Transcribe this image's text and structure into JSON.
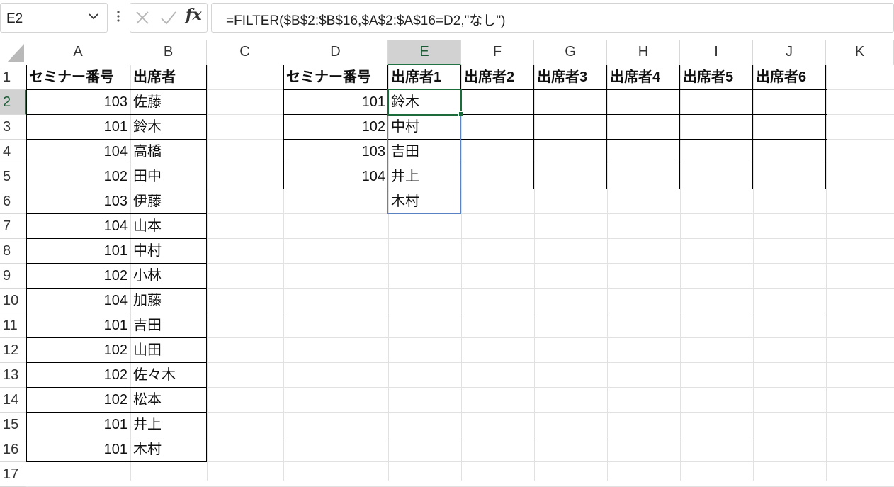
{
  "formula_bar": {
    "name_box": "E2",
    "formula": "=FILTER($B$2:$B$16,$A$2:$A$16=D2,\"なし\")",
    "fx_label": "fx"
  },
  "columns": [
    "A",
    "B",
    "C",
    "D",
    "E",
    "F",
    "G",
    "H",
    "I",
    "J",
    "K"
  ],
  "rows": [
    "1",
    "2",
    "3",
    "4",
    "5",
    "6",
    "7",
    "8",
    "9",
    "10",
    "11",
    "12",
    "13",
    "14",
    "15",
    "16",
    "17"
  ],
  "table_left": {
    "headers": [
      "セミナー番号",
      "出席者"
    ],
    "rows": [
      [
        "103",
        "佐藤"
      ],
      [
        "101",
        "鈴木"
      ],
      [
        "104",
        "高橋"
      ],
      [
        "102",
        "田中"
      ],
      [
        "103",
        "伊藤"
      ],
      [
        "104",
        "山本"
      ],
      [
        "101",
        "中村"
      ],
      [
        "102",
        "小林"
      ],
      [
        "104",
        "加藤"
      ],
      [
        "101",
        "吉田"
      ],
      [
        "102",
        "山田"
      ],
      [
        "102",
        "佐々木"
      ],
      [
        "102",
        "松本"
      ],
      [
        "101",
        "井上"
      ],
      [
        "101",
        "木村"
      ]
    ]
  },
  "table_right": {
    "headers": [
      "セミナー番号",
      "出席者1",
      "出席者2",
      "出席者3",
      "出席者4",
      "出席者5",
      "出席者6"
    ],
    "seminar_numbers": [
      "101",
      "102",
      "103",
      "104"
    ]
  },
  "spill_values": [
    "鈴木",
    "中村",
    "吉田",
    "井上",
    "木村"
  ],
  "colors": {
    "selection": "#1d6b3b",
    "spill_border": "#5b83c4",
    "gridline": "#e1e1e1"
  }
}
